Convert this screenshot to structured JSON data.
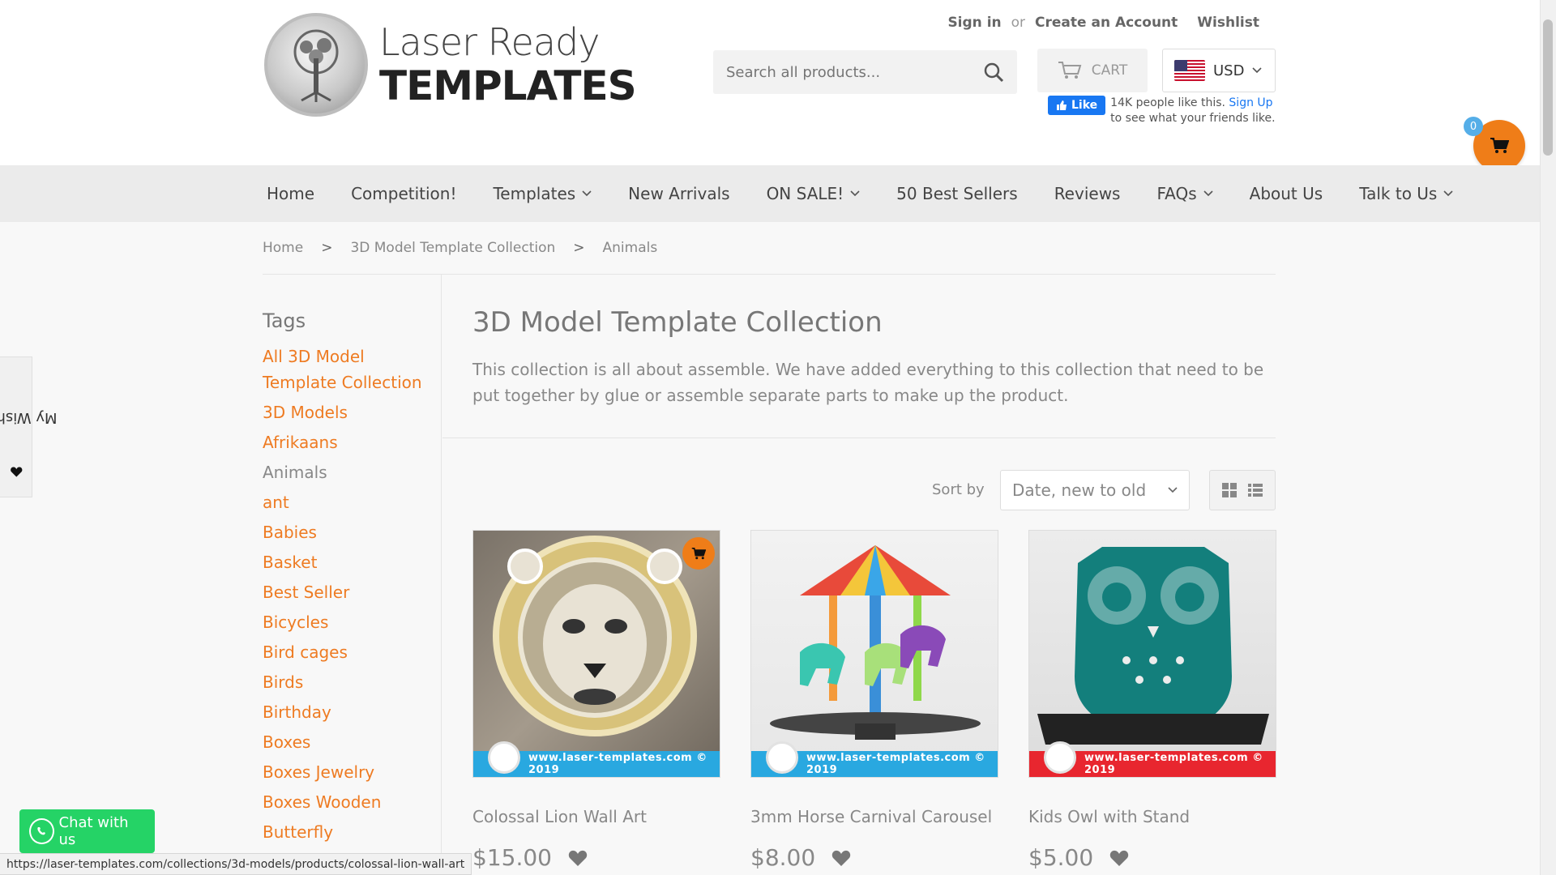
{
  "header": {
    "logo_line1": "Laser Ready",
    "logo_line2": "TEMPLATES",
    "sign_in": "Sign in",
    "or_text": "or",
    "create_account": "Create an Account",
    "wishlist": "Wishlist",
    "search_placeholder": "Search all products...",
    "cart_label": "CART",
    "currency": "USD",
    "fb_like": "Like",
    "fb_text1": "14K people like this.",
    "fb_signup": "Sign Up",
    "fb_text2": "to see what your friends like.",
    "cart_count": "0"
  },
  "nav": {
    "items": [
      {
        "label": "Home",
        "dropdown": false
      },
      {
        "label": "Competition!",
        "dropdown": false
      },
      {
        "label": "Templates",
        "dropdown": true
      },
      {
        "label": "New Arrivals",
        "dropdown": false
      },
      {
        "label": "ON SALE!",
        "dropdown": true
      },
      {
        "label": "50 Best Sellers",
        "dropdown": false
      },
      {
        "label": "Reviews",
        "dropdown": false
      },
      {
        "label": "FAQs",
        "dropdown": true
      },
      {
        "label": "About Us",
        "dropdown": false
      },
      {
        "label": "Talk to Us",
        "dropdown": true
      }
    ]
  },
  "breadcrumb": {
    "items": [
      "Home",
      "3D Model Template Collection",
      "Animals"
    ],
    "separator": ">"
  },
  "sidebar": {
    "title": "Tags",
    "tags": [
      {
        "label": "All 3D Model Template Collection",
        "current": false
      },
      {
        "label": "3D Models",
        "current": false
      },
      {
        "label": "Afrikaans",
        "current": false
      },
      {
        "label": "Animals",
        "current": true
      },
      {
        "label": "ant",
        "current": false
      },
      {
        "label": "Babies",
        "current": false
      },
      {
        "label": "Basket",
        "current": false
      },
      {
        "label": "Best Seller",
        "current": false
      },
      {
        "label": "Bicycles",
        "current": false
      },
      {
        "label": "Bird cages",
        "current": false
      },
      {
        "label": "Birds",
        "current": false
      },
      {
        "label": "Birthday",
        "current": false
      },
      {
        "label": "Boxes",
        "current": false
      },
      {
        "label": "Boxes Jewelry",
        "current": false
      },
      {
        "label": "Boxes Wooden",
        "current": false
      },
      {
        "label": "Butterfly",
        "current": false
      }
    ]
  },
  "collection": {
    "title": "3D Model Template Collection",
    "description": "This collection is all about assemble. We have added everything to this collection that need to be put together by glue or assemble separate parts to make up the product.",
    "sort_label": "Sort by",
    "sort_value": "Date, new to old"
  },
  "products": [
    {
      "name": "Colossal Lion Wall Art",
      "price": "$15.00",
      "footer": "www.laser-templates.com © 2019",
      "footer_color": "#29a8e0"
    },
    {
      "name": "3mm Horse Carnival Carousel",
      "price": "$8.00",
      "footer": "www.laser-templates.com © 2019",
      "footer_color": "#29a8e0"
    },
    {
      "name": "Kids Owl with Stand",
      "price": "$5.00",
      "footer": "www.laser-templates.com © 2019",
      "footer_color": "#e8262f"
    }
  ],
  "wishlist_tab": "My Wishlist",
  "chat": "Chat with us",
  "status_url": "https://laser-templates.com/collections/3d-models/products/colossal-lion-wall-art",
  "colors": {
    "accent": "#ee7b22",
    "cart_orange": "#ef7d18",
    "whatsapp": "#25d366"
  }
}
